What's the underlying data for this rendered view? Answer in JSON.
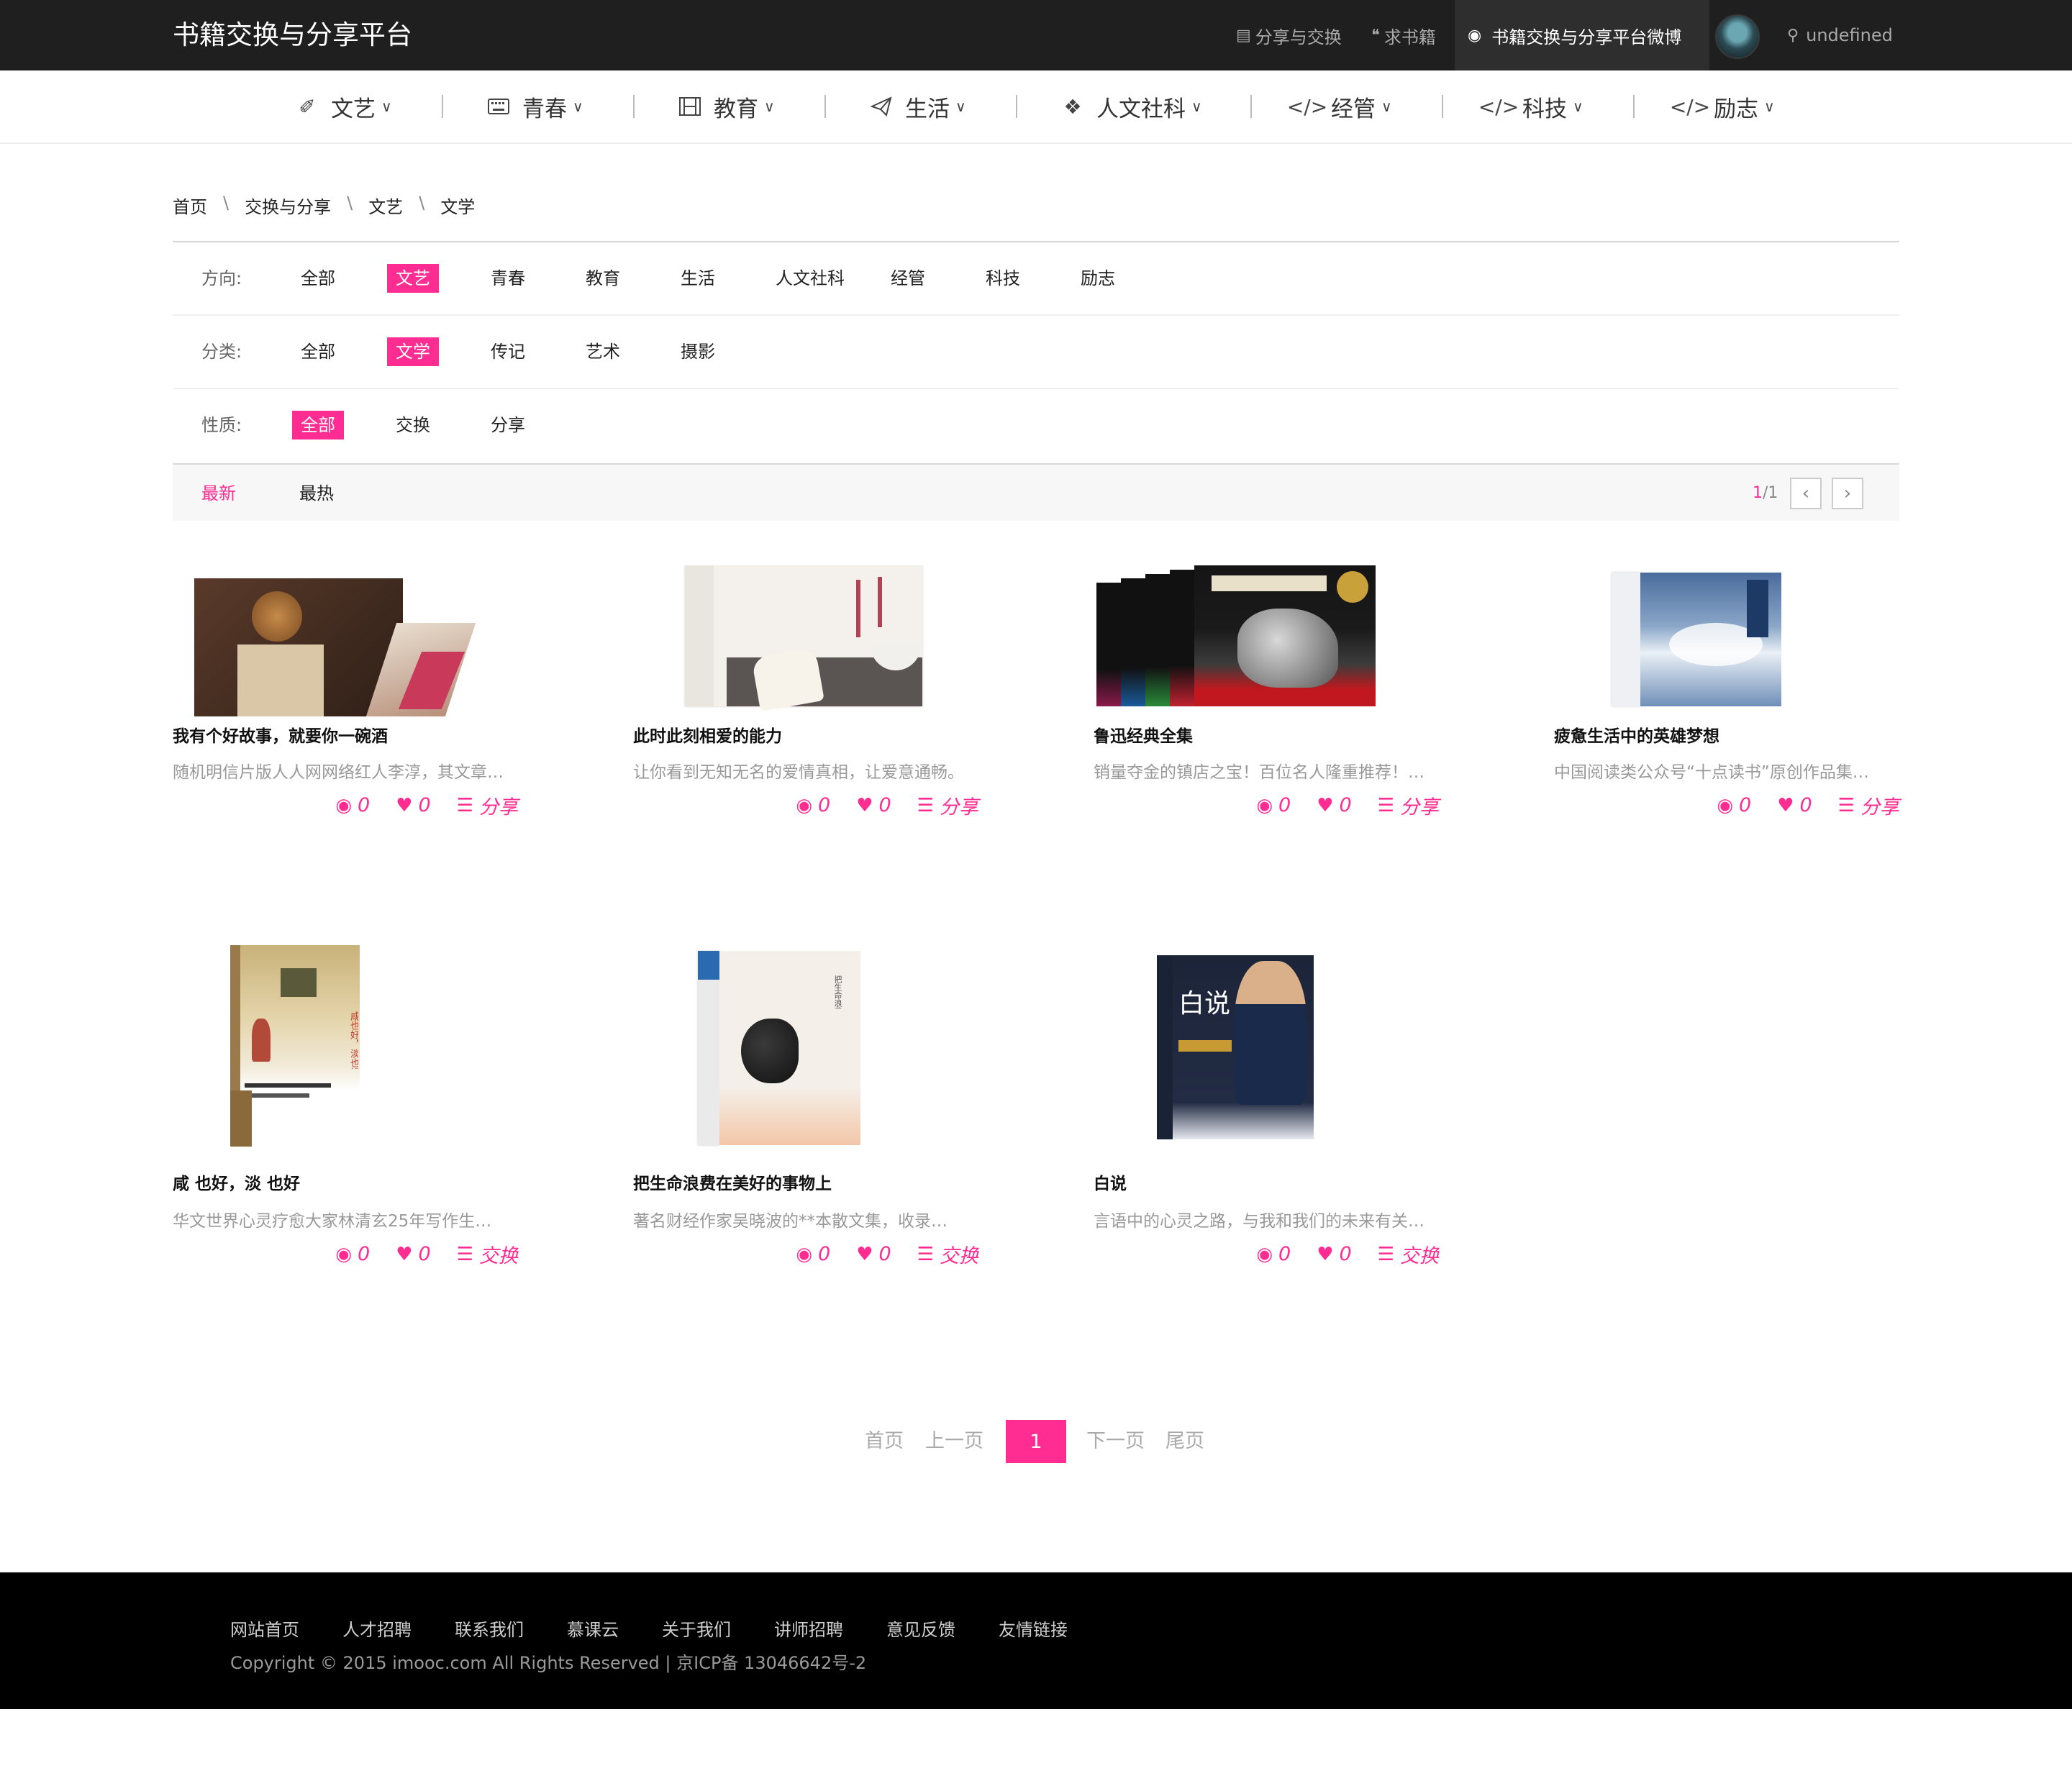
{
  "header": {
    "brand": "书籍交换与分享平台",
    "nav": [
      {
        "label": "分享与交换",
        "icon": "book-icon"
      },
      {
        "label": "求书籍",
        "icon": "quote-icon"
      },
      {
        "label": "书籍交换与分享平台微博",
        "icon": "weibo-icon"
      }
    ],
    "location": "undefined"
  },
  "categories": [
    {
      "label": "文艺",
      "icon": "brush-icon"
    },
    {
      "label": "青春",
      "icon": "keyboard-icon"
    },
    {
      "label": "教育",
      "icon": "film-icon"
    },
    {
      "label": "生活",
      "icon": "paper-plane-icon"
    },
    {
      "label": "人文社科",
      "icon": "dropbox-icon"
    },
    {
      "label": "经管",
      "icon": "code-icon"
    },
    {
      "label": "科技",
      "icon": "code-icon"
    },
    {
      "label": "励志",
      "icon": "code-icon"
    }
  ],
  "breadcrumb": [
    "首页",
    "交换与分享",
    "文艺",
    "文学"
  ],
  "filters": {
    "direction": {
      "label": "方向:",
      "items": [
        "全部",
        "文艺",
        "青春",
        "教育",
        "生活",
        "人文社科",
        "经管",
        "科技",
        "励志"
      ],
      "active": "文艺"
    },
    "category": {
      "label": "分类:",
      "items": [
        "全部",
        "文学",
        "传记",
        "艺术",
        "摄影"
      ],
      "active": "文学"
    },
    "nature": {
      "label": "性质:",
      "items": [
        "全部",
        "交换",
        "分享"
      ],
      "active": "全部"
    }
  },
  "sort": {
    "newest": "最新",
    "hottest": "最热",
    "page_current": "1",
    "page_total": "/1"
  },
  "books": [
    {
      "title": "我有个好故事，就要你一碗酒",
      "desc": "随机明信片版人人网网络红人李淳，其文章…",
      "views": "0",
      "likes": "0",
      "type": "分享"
    },
    {
      "title": "此时此刻相爱的能力",
      "desc": "让你看到无知无名的爱情真相，让爱意通畅。",
      "views": "0",
      "likes": "0",
      "type": "分享"
    },
    {
      "title": "鲁迅经典全集",
      "desc": "销量夺金的镇店之宝！百位名人隆重推荐！…",
      "views": "0",
      "likes": "0",
      "type": "分享"
    },
    {
      "title": "疲惫生活中的英雄梦想",
      "desc": "中国阅读类公众号“十点读书”原创作品集…",
      "views": "0",
      "likes": "0",
      "type": "分享"
    },
    {
      "title": "咸 也好，淡 也好",
      "desc": "华文世界心灵疗愈大家林清玄25年写作生…",
      "views": "0",
      "likes": "0",
      "type": "交换"
    },
    {
      "title": "把生命浪费在美好的事物上",
      "desc": "著名财经作家吴晓波的**本散文集，收录…",
      "views": "0",
      "likes": "0",
      "type": "交换"
    },
    {
      "title": "白说",
      "desc": "言语中的心灵之路，与我和我们的未来有关…",
      "views": "0",
      "likes": "0",
      "type": "交换"
    }
  ],
  "covers": {
    "book5_title": "咸也好，淡也好",
    "book6_title": "把生命浪费在美好的事物上",
    "book7_title": "白说"
  },
  "pagination": {
    "first": "首页",
    "prev": "上一页",
    "current": "1",
    "next": "下一页",
    "last": "尾页"
  },
  "footer": {
    "links": [
      "网站首页",
      "人才招聘",
      "联系我们",
      "慕课云",
      "关于我们",
      "讲师招聘",
      "意见反馈",
      "友情链接"
    ],
    "copyright": "Copyright © 2015 imooc.com All Rights Reserved | 京ICP备 13046642号-2"
  },
  "colors": {
    "accent": "#ff2d92",
    "topbar": "#1f1f1f",
    "footer": "#000000"
  }
}
